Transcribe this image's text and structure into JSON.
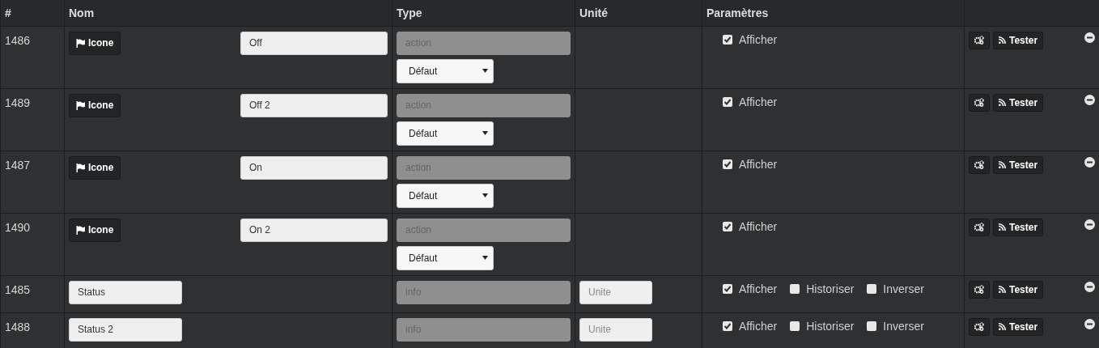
{
  "table": {
    "columns": [
      "#",
      "Nom",
      "Type",
      "Unité",
      "Paramètres"
    ],
    "rows": [
      {
        "kind": "action",
        "id": "1486",
        "icon_button": "Icone",
        "name": "Off",
        "type": "action",
        "subtype": "Défaut",
        "params": [
          {
            "label": "Afficher",
            "checked": true
          }
        ],
        "buttons": [
          "Tester"
        ]
      },
      {
        "kind": "action",
        "id": "1489",
        "icon_button": "Icone",
        "name": "Off 2",
        "type": "action",
        "subtype": "Défaut",
        "params": [
          {
            "label": "Afficher",
            "checked": true
          }
        ],
        "buttons": [
          "Tester"
        ]
      },
      {
        "kind": "action",
        "id": "1487",
        "icon_button": "Icone",
        "name": "On",
        "type": "action",
        "subtype": "Défaut",
        "params": [
          {
            "label": "Afficher",
            "checked": true
          }
        ],
        "buttons": [
          "Tester"
        ]
      },
      {
        "kind": "action",
        "id": "1490",
        "icon_button": "Icone",
        "name": "On 2",
        "type": "action",
        "subtype": "Défaut",
        "params": [
          {
            "label": "Afficher",
            "checked": true
          }
        ],
        "buttons": [
          "Tester"
        ]
      },
      {
        "kind": "info",
        "id": "1485",
        "name": "Status",
        "type": "info",
        "unit_placeholder": "Unite",
        "params": [
          {
            "label": "Afficher",
            "checked": true
          },
          {
            "label": "Historiser",
            "checked": false
          },
          {
            "label": "Inverser",
            "checked": false
          }
        ],
        "buttons": [
          "Tester"
        ]
      },
      {
        "kind": "info",
        "id": "1488",
        "name": "Status 2",
        "type": "info",
        "unit_placeholder": "Unite",
        "params": [
          {
            "label": "Afficher",
            "checked": true
          },
          {
            "label": "Historiser",
            "checked": false
          },
          {
            "label": "Inverser",
            "checked": false
          }
        ],
        "buttons": [
          "Tester"
        ]
      }
    ]
  }
}
